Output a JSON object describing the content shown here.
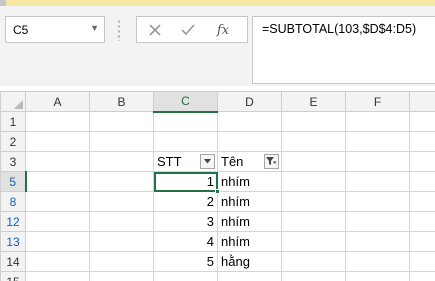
{
  "name_box": {
    "value": "C5"
  },
  "formula_bar": {
    "formula": "=SUBTOTAL(103,$D$4:D5)",
    "fx_label": "fx"
  },
  "columns": [
    "A",
    "B",
    "C",
    "D",
    "E",
    "F"
  ],
  "rows": [
    {
      "num": "1",
      "c": "",
      "d": ""
    },
    {
      "num": "2",
      "c": "",
      "d": ""
    },
    {
      "num": "3",
      "c": "STT",
      "d": "Tên"
    },
    {
      "num": "5",
      "c": "1",
      "d": "nhím"
    },
    {
      "num": "8",
      "c": "2",
      "d": "nhím"
    },
    {
      "num": "12",
      "c": "3",
      "d": "nhím"
    },
    {
      "num": "13",
      "c": "4",
      "d": "nhím"
    },
    {
      "num": "14",
      "c": "5",
      "d": "hằng"
    },
    {
      "num": "15",
      "c": "",
      "d": ""
    }
  ],
  "colors": {
    "accent_green": "#217346",
    "filtered_row_number": "#1a5fb4"
  },
  "icons": {
    "cancel": "close-icon",
    "enter": "checkmark-icon",
    "filter_dropdown": "dropdown-arrow-icon",
    "filter_active": "filter-funnel-icon"
  }
}
